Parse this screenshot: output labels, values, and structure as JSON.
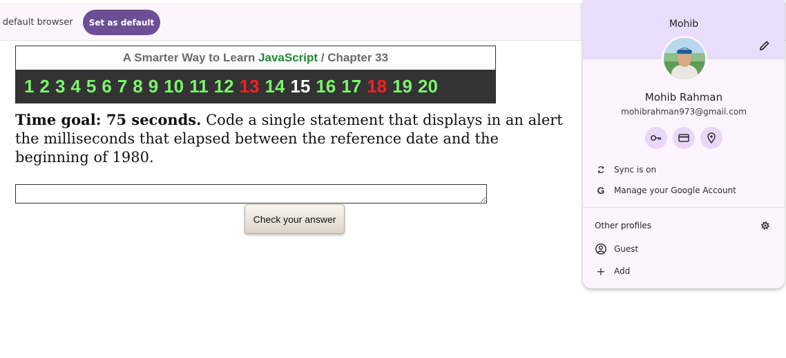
{
  "infobar": {
    "text": "ur default browser",
    "button_label": "Set as default"
  },
  "lesson": {
    "title_prefix": "A Smarter Way to Learn ",
    "title_js": "JavaScript",
    "title_suffix": " / Chapter 33",
    "chapters": [
      {
        "n": "1",
        "color": "#7cf56e"
      },
      {
        "n": "2",
        "color": "#7cf56e"
      },
      {
        "n": "3",
        "color": "#7cf56e"
      },
      {
        "n": "4",
        "color": "#7cf56e"
      },
      {
        "n": "5",
        "color": "#7cf56e"
      },
      {
        "n": "6",
        "color": "#7cf56e"
      },
      {
        "n": "7",
        "color": "#7cf56e"
      },
      {
        "n": "8",
        "color": "#7cf56e"
      },
      {
        "n": "9",
        "color": "#7cf56e"
      },
      {
        "n": "10",
        "color": "#7cf56e"
      },
      {
        "n": "11",
        "color": "#7cf56e"
      },
      {
        "n": "12",
        "color": "#7cf56e"
      },
      {
        "n": "13",
        "color": "#ff1f1f"
      },
      {
        "n": "14",
        "color": "#7cf56e"
      },
      {
        "n": "15",
        "color": "#ffffff"
      },
      {
        "n": "16",
        "color": "#7cf56e"
      },
      {
        "n": "17",
        "color": "#7cf56e"
      },
      {
        "n": "18",
        "color": "#ff1f1f"
      },
      {
        "n": "19",
        "color": "#7cf56e"
      },
      {
        "n": "20",
        "color": "#7cf56e"
      }
    ],
    "time_goal": "Time goal: 75 seconds.",
    "question": " Code a single statement that displays in an alert the milliseconds that elapsed between the reference date and the beginning of 1980.",
    "answer_value": "",
    "check_label": "Check your answer"
  },
  "profile": {
    "top_name": "Mohib",
    "full_name": "Mohib Rahman",
    "email": "mohibrahman973@gmail.com",
    "quick_icons": [
      "key-icon",
      "card-icon",
      "location-icon"
    ],
    "sync_label": "Sync is on",
    "manage_label": "Manage your Google Account",
    "other_profiles_label": "Other profiles",
    "guest_label": "Guest",
    "add_label": "Add"
  }
}
